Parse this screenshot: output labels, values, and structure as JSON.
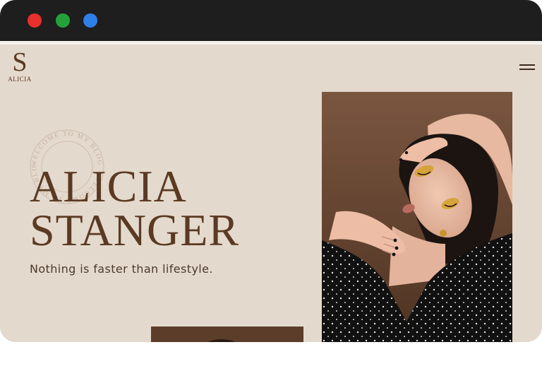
{
  "window": {
    "controls": [
      "close",
      "minimize",
      "maximize"
    ],
    "colors": {
      "close": "#e8302c",
      "minimize": "#24a23a",
      "maximize": "#2f7fe8"
    }
  },
  "logo": {
    "mark": "S",
    "name": "ALICIA"
  },
  "nav": {
    "menu_icon": "hamburger-icon"
  },
  "hero": {
    "stamp_text": "WELCOME TO MY BLOG · WELCOME TO MY BLOG · ",
    "title_line1": "ALICIA",
    "title_line2": "STANGER",
    "tagline": "Nothing is faster than lifestyle."
  },
  "theme": {
    "background": "#e4d9cd",
    "accent": "#5b3a23"
  }
}
